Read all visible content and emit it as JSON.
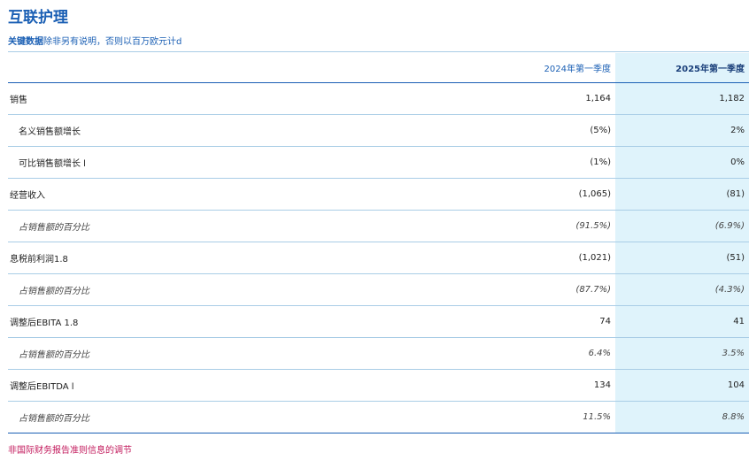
{
  "title": "互联护理",
  "subtitle": {
    "bold": "关键数据",
    "rest": "除非另有说明，否则以百万欧元计d"
  },
  "table": {
    "columns": [
      "",
      "2024年第一季度",
      "2025年第一季度"
    ],
    "rows": [
      {
        "label": "销售",
        "v2024": "1,164",
        "v2025": "1,182",
        "indent": false,
        "pct": false
      },
      {
        "label": "名义销售额增长",
        "v2024": "(5%)",
        "v2025": "2%",
        "indent": true,
        "pct": false
      },
      {
        "label": "可比销售额增长 l",
        "v2024": "(1%)",
        "v2025": "0%",
        "indent": true,
        "pct": false
      },
      {
        "label": "经营收入",
        "v2024": "(1,065)",
        "v2025": "(81)",
        "indent": false,
        "pct": false
      },
      {
        "label": "占销售额的百分比",
        "v2024": "(91.5%)",
        "v2025": "(6.9%)",
        "indent": true,
        "pct": true
      },
      {
        "label": "息税前利润1.8",
        "v2024": "(1,021)",
        "v2025": "(51)",
        "indent": false,
        "pct": false
      },
      {
        "label": "占销售额的百分比",
        "v2024": "(87.7%)",
        "v2025": "(4.3%)",
        "indent": true,
        "pct": true
      },
      {
        "label": "调整后EBITA 1.8",
        "v2024": "74",
        "v2025": "41",
        "indent": false,
        "pct": false
      },
      {
        "label": "占销售额的百分比",
        "v2024": "6.4%",
        "v2025": "3.5%",
        "indent": true,
        "pct": true
      },
      {
        "label": "调整后EBITDA l",
        "v2024": "134",
        "v2025": "104",
        "indent": false,
        "pct": false
      },
      {
        "label": "占销售额的百分比",
        "v2024": "11.5%",
        "v2025": "8.8%",
        "indent": true,
        "pct": true
      }
    ]
  },
  "footnote": "非国际财务报告准则信息的调节",
  "colors": {
    "title": "#1a5fb4",
    "highlight_column": "#dff3fb",
    "rule": "#a9cde6",
    "footnote": "#c2185b"
  }
}
